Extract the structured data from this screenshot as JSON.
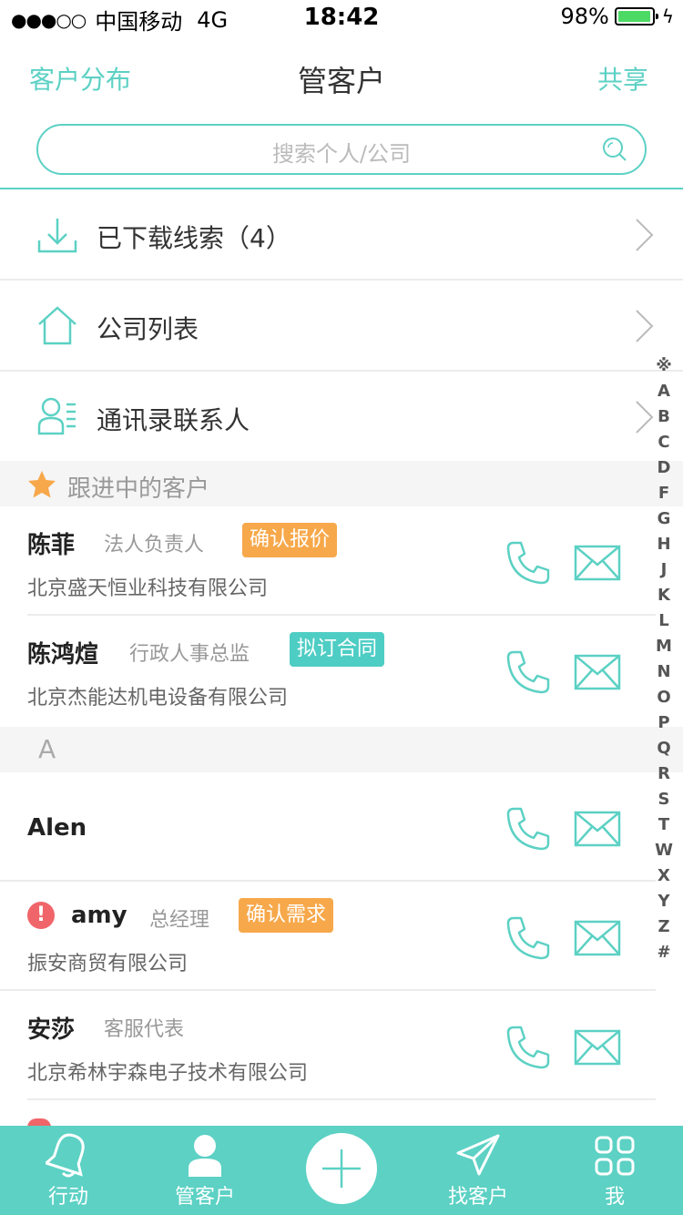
{
  "status_bar": {
    "signal": "●●●○○",
    "carrier": "中国移动",
    "network": "4G",
    "time": "18:42",
    "battery": "98%",
    "battery_level": 0.98
  },
  "nav": {
    "left": "客户分布",
    "title": "管客户",
    "right": "共享"
  },
  "search": {
    "placeholder": "搜索个人/公司"
  },
  "menu": [
    {
      "label": "已下载线索（4）",
      "icon": "download-icon"
    },
    {
      "label": "公司列表",
      "icon": "home-icon"
    },
    {
      "label": "通讯录联系人",
      "icon": "contacts-icon"
    }
  ],
  "sections": {
    "following": "跟进中的客户",
    "letter_a": "A"
  },
  "contacts": [
    {
      "name": "陈菲",
      "title": "法人负责人",
      "tag": "确认报价",
      "tag_color": "#f7a84a",
      "company": "北京盛天恒业科技有限公司"
    },
    {
      "name": "陈鸿煊",
      "title": "行政人事总监",
      "tag": "拟订合同",
      "tag_color": "#4ecdc4",
      "company": "北京杰能达机电设备有限公司"
    },
    {
      "name": "Alen",
      "title": "",
      "tag": "",
      "company": ""
    },
    {
      "name": "amy",
      "title": "总经理",
      "tag": "确认需求",
      "tag_color": "#f7a84a",
      "company": "振安商贸有限公司",
      "alert": "!"
    },
    {
      "name": "安莎",
      "title": "客服代表",
      "tag": "",
      "company": "北京希林宇森电子技术有限公司"
    }
  ],
  "index": [
    "※",
    "A",
    "B",
    "C",
    "D",
    "F",
    "G",
    "H",
    "J",
    "K",
    "L",
    "M",
    "N",
    "O",
    "P",
    "Q",
    "R",
    "S",
    "T",
    "W",
    "X",
    "Y",
    "Z",
    "#"
  ],
  "tabbar": {
    "items": [
      {
        "label": "行动",
        "icon": "bell-icon"
      },
      {
        "label": "管客户",
        "icon": "person-icon"
      },
      {
        "label": "",
        "icon": "plus-icon"
      },
      {
        "label": "找客户",
        "icon": "paper-plane-icon"
      },
      {
        "label": "我",
        "icon": "grid-icon"
      }
    ]
  },
  "colors": {
    "accent": "#5cd1c4",
    "orange_tag": "#f7a84a",
    "alert": "#f0656a"
  }
}
